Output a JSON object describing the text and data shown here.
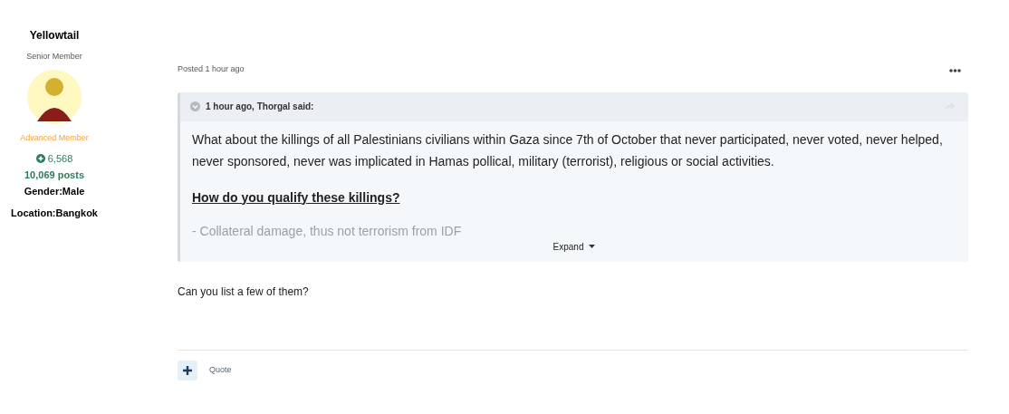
{
  "author": {
    "name": "Yellowtail",
    "title": "Senior Member",
    "rank": "Advanced Member",
    "reputation": "6,568",
    "posts": "10,069 posts",
    "gender": {
      "label": "Gender:",
      "value": "Male"
    },
    "location": {
      "label": "Location:",
      "value": "Bangkok"
    }
  },
  "post": {
    "posted": "Posted 1 hour ago",
    "quote": {
      "citation": "1 hour ago, Thorgal said:",
      "paragraphs": [
        {
          "kind": "text",
          "text": "What about the killings of all Palestinians civilians within Gaza since 7th of October that never participated, never voted, never helped, never sponsored, never was implicated in Hamas pollical, military (terrorist), religious or social activities."
        },
        {
          "kind": "heading",
          "text": "How do you qualify these killings?"
        },
        {
          "kind": "faded",
          "text": "- Collateral damage, thus not terrorism from IDF"
        }
      ],
      "expand": "Expand"
    },
    "body": "Can you list a few of them?",
    "actions": {
      "quote": "Quote"
    }
  }
}
